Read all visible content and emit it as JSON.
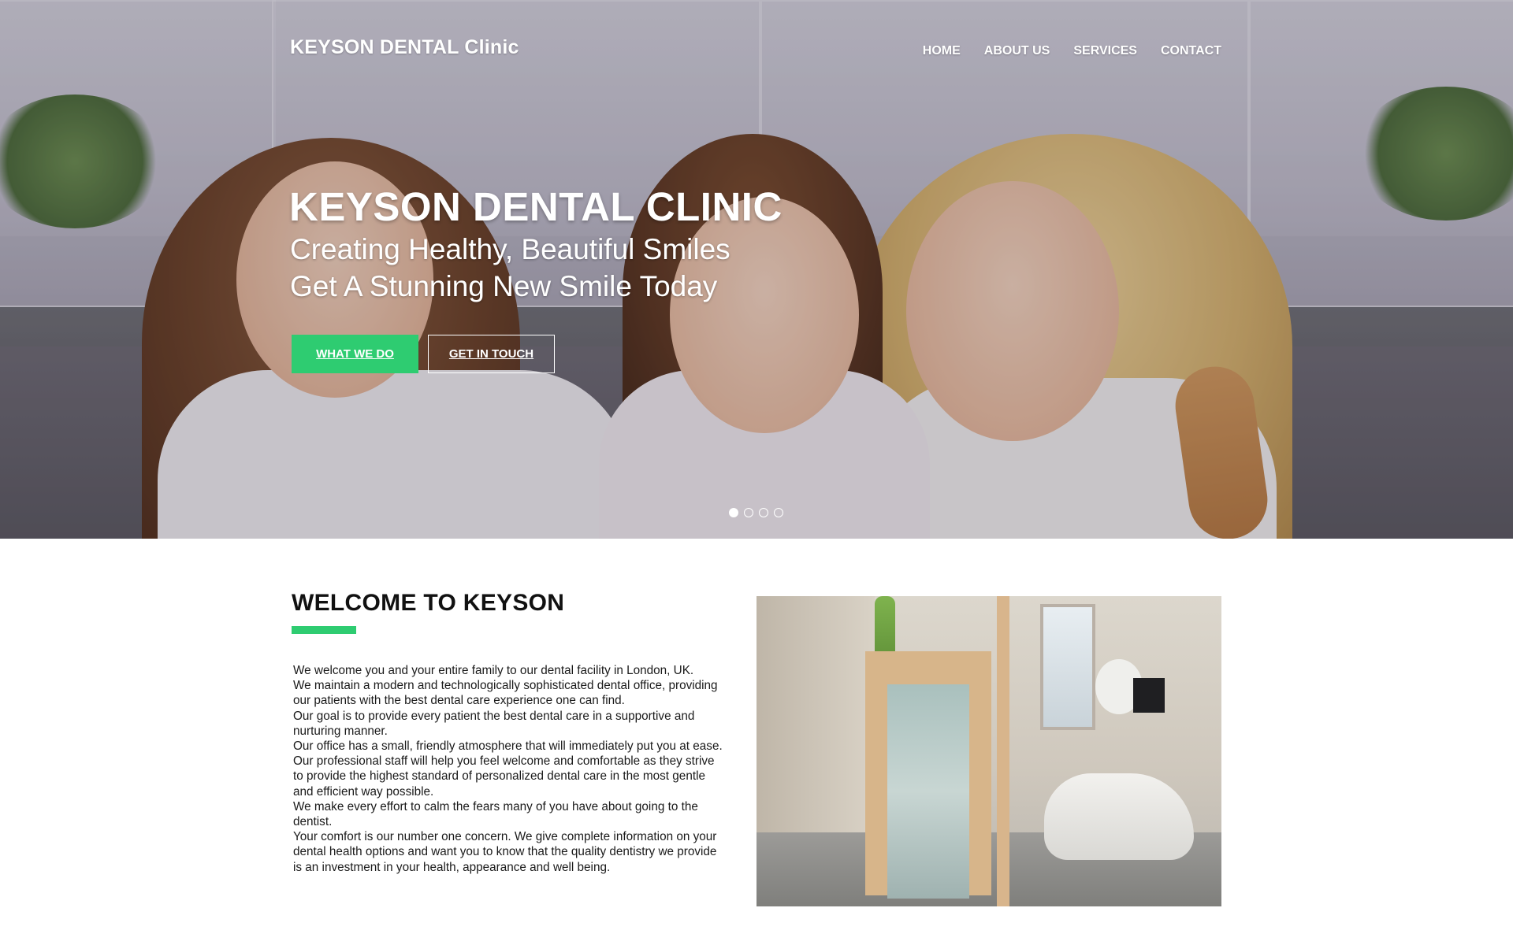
{
  "header": {
    "brand": "KEYSON DENTAL Clinic",
    "nav": [
      "HOME",
      "ABOUT US",
      "SERVICES",
      "CONTACT"
    ]
  },
  "hero": {
    "title": "KEYSON DENTAL CLINIC",
    "subtitle_1": "Creating Healthy, Beautiful Smiles",
    "subtitle_2": "Get A Stunning New Smile Today",
    "primary_button": "WHAT WE DO",
    "secondary_button": "GET IN TOUCH",
    "slides_count": 4,
    "active_slide": 1
  },
  "welcome": {
    "title": "WELCOME TO KEYSON",
    "paragraphs": [
      "We welcome you and your entire family to our dental facility in London, UK.",
      "We maintain a modern and technologically sophisticated dental office, providing our patients with the best dental care experience one can find.",
      "Our goal is to provide every patient the best dental care in a supportive and nurturing manner.",
      "Our office has a small, friendly atmosphere that will immediately put you at ease.",
      "Our professional staff will help you feel welcome and comfortable as they strive to provide the highest standard of personalized dental care in the most gentle and efficient way possible.",
      "We make every effort to calm the fears many of you have about going to the dentist.",
      "Your comfort is our number one concern. We give complete information on your dental health options and want you to know  that the quality dentistry we provide is an investment in your health, appearance and well being."
    ]
  },
  "colors": {
    "accent": "#2ecc71",
    "text_dark": "#111111",
    "white": "#ffffff"
  }
}
